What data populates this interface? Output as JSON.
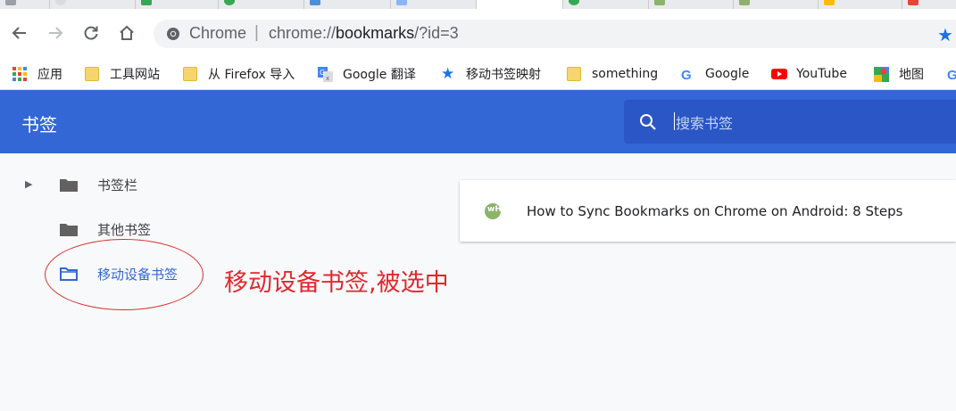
{
  "toolbar": {
    "scheme_label": "Chrome",
    "separator": "|",
    "url_prefix": "chrome://",
    "url_host": "bookmarks",
    "url_suffix": "/?id=3"
  },
  "bookmarks_bar": [
    {
      "label": "应用",
      "icon": "apps-grid-icon"
    },
    {
      "label": "工具网站",
      "icon": "folder-icon"
    },
    {
      "label": "从 Firefox 导入",
      "icon": "folder-icon"
    },
    {
      "label": "Google 翻译",
      "icon": "google-translate-icon"
    },
    {
      "label": "移动书签映射",
      "icon": "star-icon"
    },
    {
      "label": "something",
      "icon": "folder-icon"
    },
    {
      "label": "Google",
      "icon": "google-icon"
    },
    {
      "label": "YouTube",
      "icon": "youtube-icon"
    },
    {
      "label": "地图",
      "icon": "maps-icon"
    }
  ],
  "header": {
    "title": "书签",
    "search_placeholder": "搜索书签"
  },
  "sidebar": {
    "items": [
      {
        "label": "书签栏",
        "expandable": true,
        "selected": false
      },
      {
        "label": "其他书签",
        "expandable": false,
        "selected": false
      },
      {
        "label": "移动设备书签",
        "expandable": false,
        "selected": true
      }
    ]
  },
  "annotation": {
    "text": "移动设备书签,被选中",
    "color": "#e0282d"
  },
  "bookmark_list": [
    {
      "title": "How to Sync Bookmarks on Chrome on Android: 8 Steps",
      "favicon_text": "wH"
    }
  ],
  "colors": {
    "header": "#3367d6",
    "search_box": "#2a56c6",
    "selected_text": "#3367d6"
  }
}
